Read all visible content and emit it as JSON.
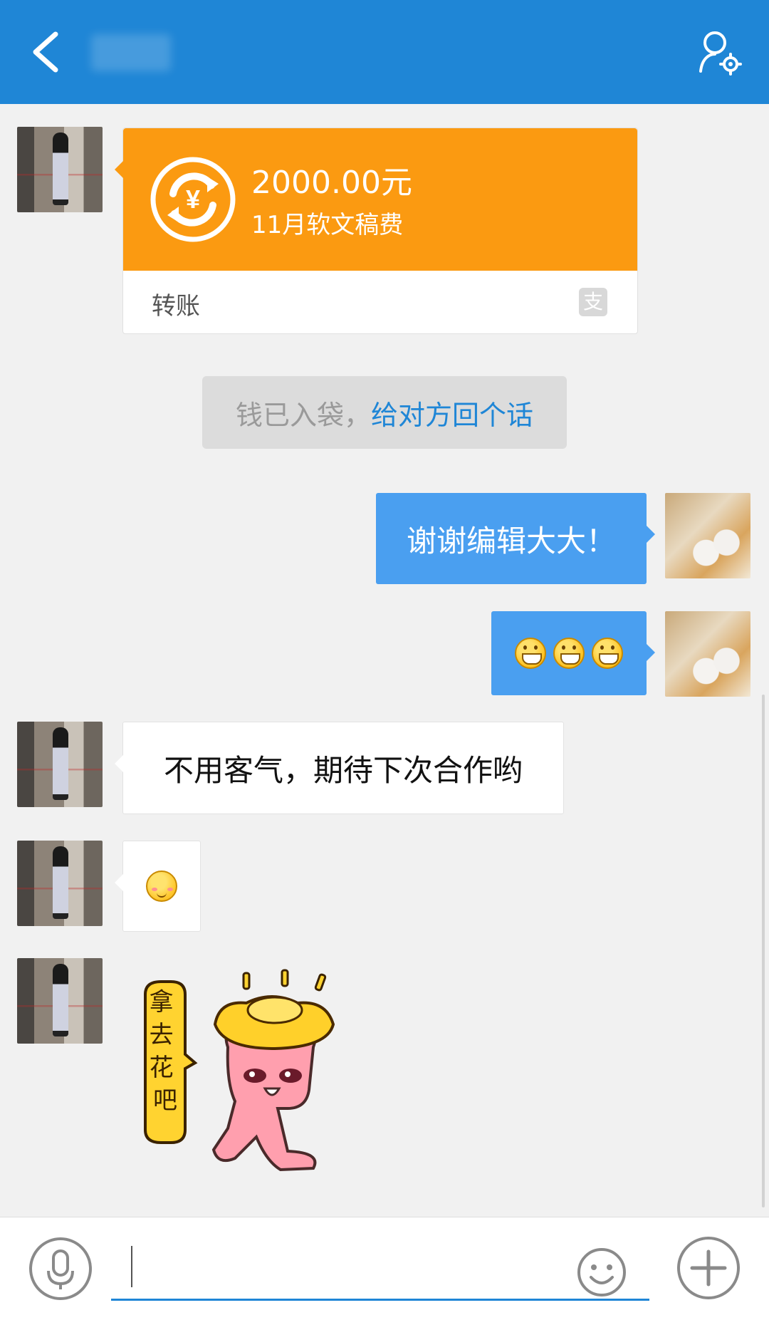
{
  "header": {
    "title": "",
    "back_icon": "chevron-left-icon",
    "profile_icon": "user-settings-icon",
    "background": "#1f86d6"
  },
  "transfer": {
    "amount": "2000.00元",
    "note": "11月软文稿费",
    "type_label": "转账",
    "icon": "transfer-yuan-icon",
    "badge_icon": "alipay-icon",
    "badge_glyph": "支",
    "color": "#fb9a11"
  },
  "notice": {
    "prefix": "钱已入袋，",
    "link": "给对方回个话"
  },
  "messages": {
    "m1": "谢谢编辑大大！",
    "m2_emojis": [
      "grin-emoji",
      "grin-emoji",
      "grin-emoji"
    ],
    "m3": "不用客气，期待下次合作哟",
    "m4_emoji": "blush-emoji",
    "sticker": {
      "icon": "gold-ingot-sticker",
      "text": "拿去花吧"
    }
  },
  "inputbar": {
    "voice_icon": "microphone-icon",
    "emoji_icon": "smiley-icon",
    "plus_icon": "plus-icon",
    "value": ""
  }
}
